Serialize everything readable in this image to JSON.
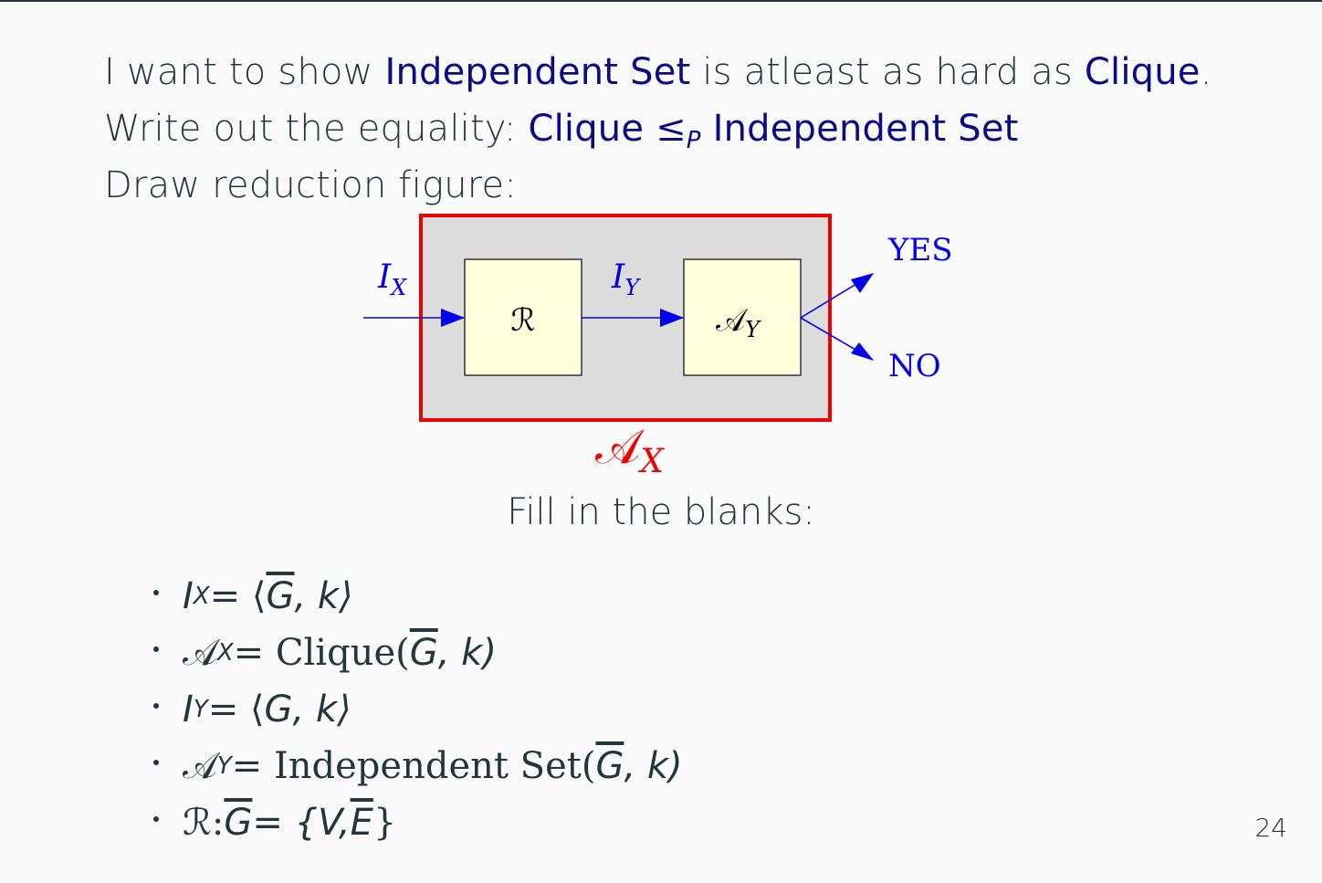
{
  "slide": {
    "line1": {
      "pre": "I want to show ",
      "term1": "Independent Set",
      "mid": " is atleast as hard as ",
      "term2": "Clique",
      "post": "."
    },
    "line2": {
      "pre": "Write out the equality: ",
      "term1": "Clique",
      "op": " ≤",
      "op_sub": "P",
      "term2": " Independent Set"
    },
    "line3": "Draw reduction figure:",
    "fill_heading": "Fill in the blanks:",
    "page_number": "24"
  },
  "figure": {
    "input_label": "I",
    "input_sub": "X",
    "reducer_label": "ℛ",
    "mid_label": "I",
    "mid_sub": "Y",
    "solver_label": "𝒜",
    "solver_sub": "Y",
    "yes_label": "YES",
    "no_label": "NO",
    "outer_label": "𝒜",
    "outer_sub": "X",
    "colors": {
      "arrow": "#0000ee",
      "outer_border": "#ee0000",
      "outer_fill": "#dcdcdc",
      "box_fill": "#ffffdd",
      "highlight": "#0b0b8a"
    }
  },
  "bullets": [
    {
      "lhs": "I",
      "lhs_sub": "X",
      "eq": " = ⟨",
      "arg1": "G",
      "rest": ", k⟩"
    },
    {
      "lhs": "𝒜",
      "lhs_sub": "X",
      "eq": " = Clique(",
      "arg1": "G",
      "rest": ", k)"
    },
    {
      "lhs": "I",
      "lhs_sub": "Y",
      "eq": " = ⟨",
      "arg1": "G",
      "rest": ", k⟩"
    },
    {
      "lhs": "𝒜",
      "lhs_sub": "Y",
      "eq": " = Independent Set(",
      "arg1": "G",
      "rest": ", k)"
    },
    {
      "lhs": "ℛ",
      "lhs_sub": "",
      "eq": " : ",
      "arg1": "G",
      "rest": " = {V, ",
      "arg2": "E",
      "end": "}"
    }
  ]
}
